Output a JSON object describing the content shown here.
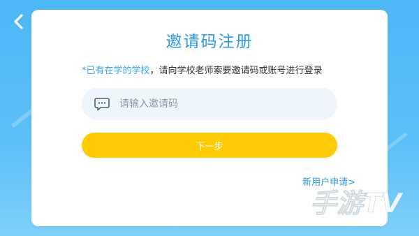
{
  "page": {
    "title": "邀请码注册",
    "notice_highlight": "*已有在学的学校",
    "notice_rest": "，请向学校老师索要邀请码或账号进行登录",
    "code_input": {
      "placeholder": "请输入邀请码",
      "value": "",
      "icon": "message-bubble-icon"
    },
    "next_button": "下一步",
    "apply_link": "新用户申请>",
    "back_icon": "chevron-left-icon"
  },
  "watermark": {
    "text": "手游TV"
  },
  "colors": {
    "background": "#4db8f6",
    "accent": "#2b9be6",
    "button": "#ffcb05",
    "input_bg": "#eef5fc"
  }
}
